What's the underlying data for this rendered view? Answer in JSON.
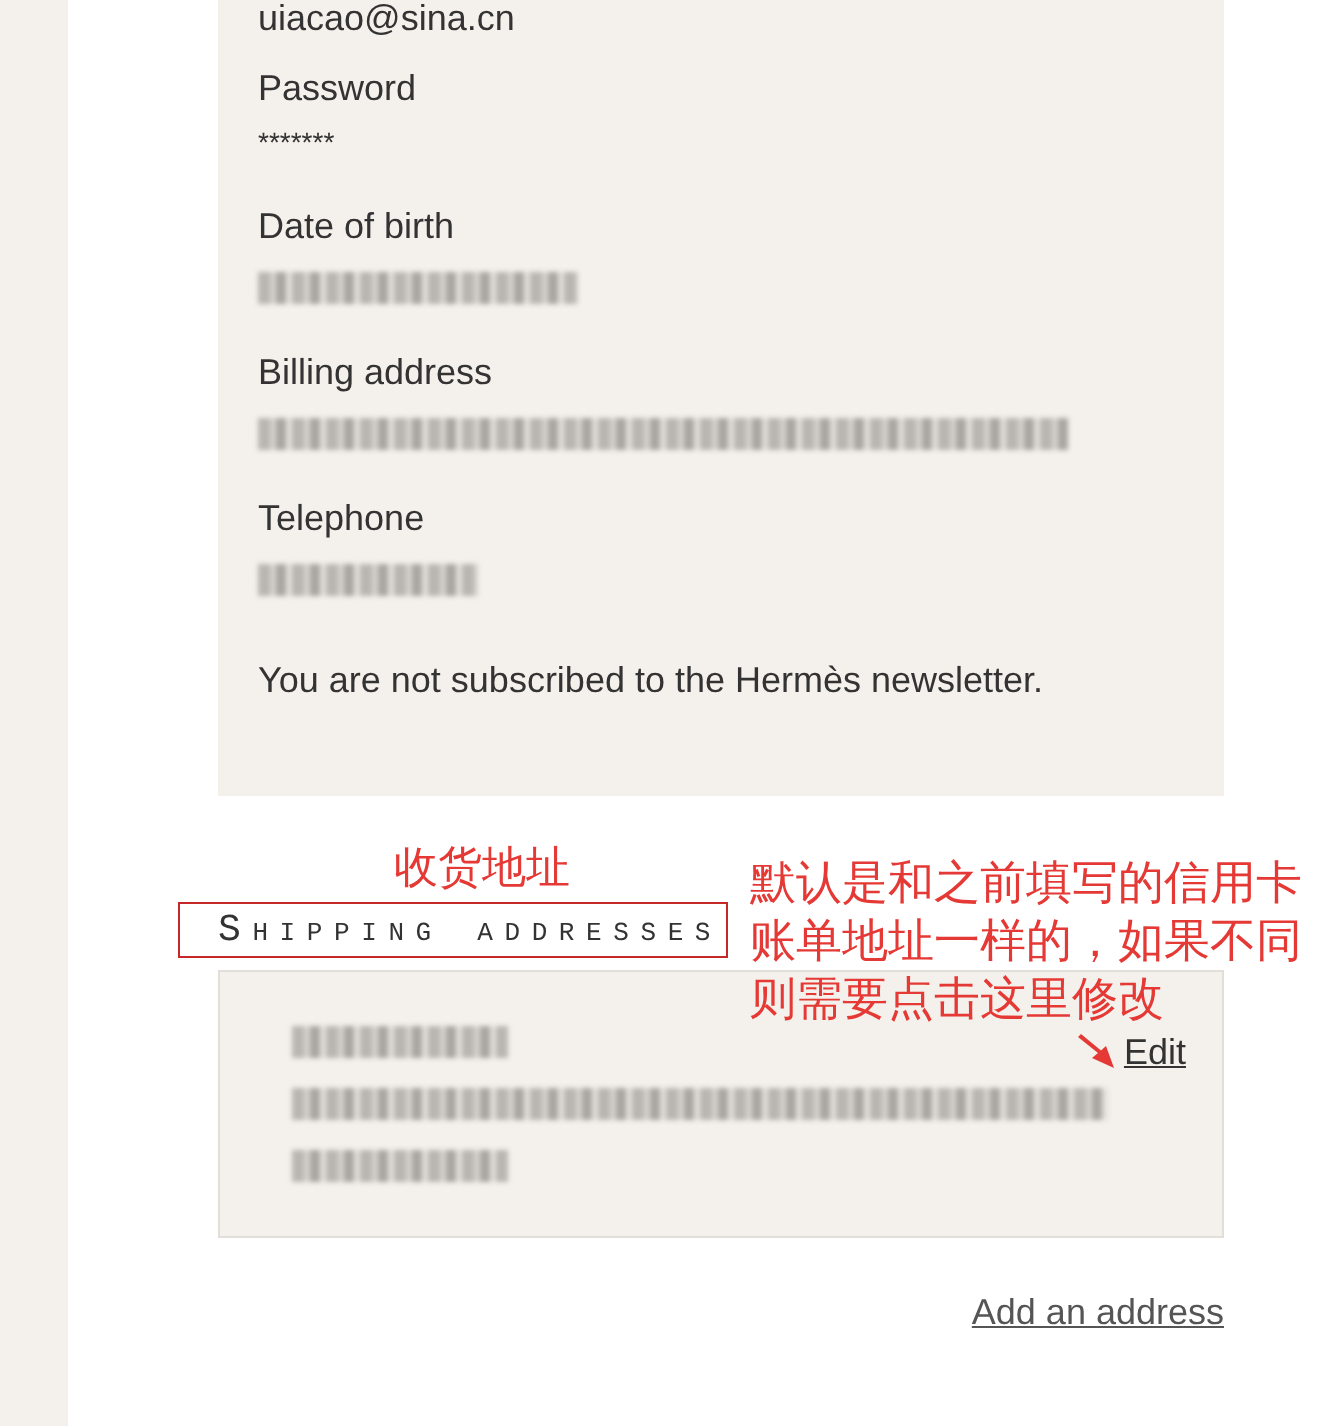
{
  "account": {
    "email": "uiacao@sina.cn",
    "fields": [
      {
        "label": "Password",
        "value": "*******",
        "redacted": false
      },
      {
        "label": "Date of birth",
        "redacted": true
      },
      {
        "label": "Billing address",
        "redacted": true
      },
      {
        "label": "Telephone",
        "redacted": true
      }
    ],
    "newsletter": "You are not subscribed to the Hermès newsletter."
  },
  "shipping": {
    "heading": "Shipping addresses",
    "address_lines": [
      {
        "redacted": true
      },
      {
        "redacted": true
      },
      {
        "redacted": true
      }
    ],
    "edit_link": "Edit",
    "add_link": "Add an address"
  },
  "annotations": {
    "heading_note": "收货地址",
    "edit_note": "默认是和之前填写的信用卡账单地址一样的，如果不同则需要点击这里修改"
  }
}
